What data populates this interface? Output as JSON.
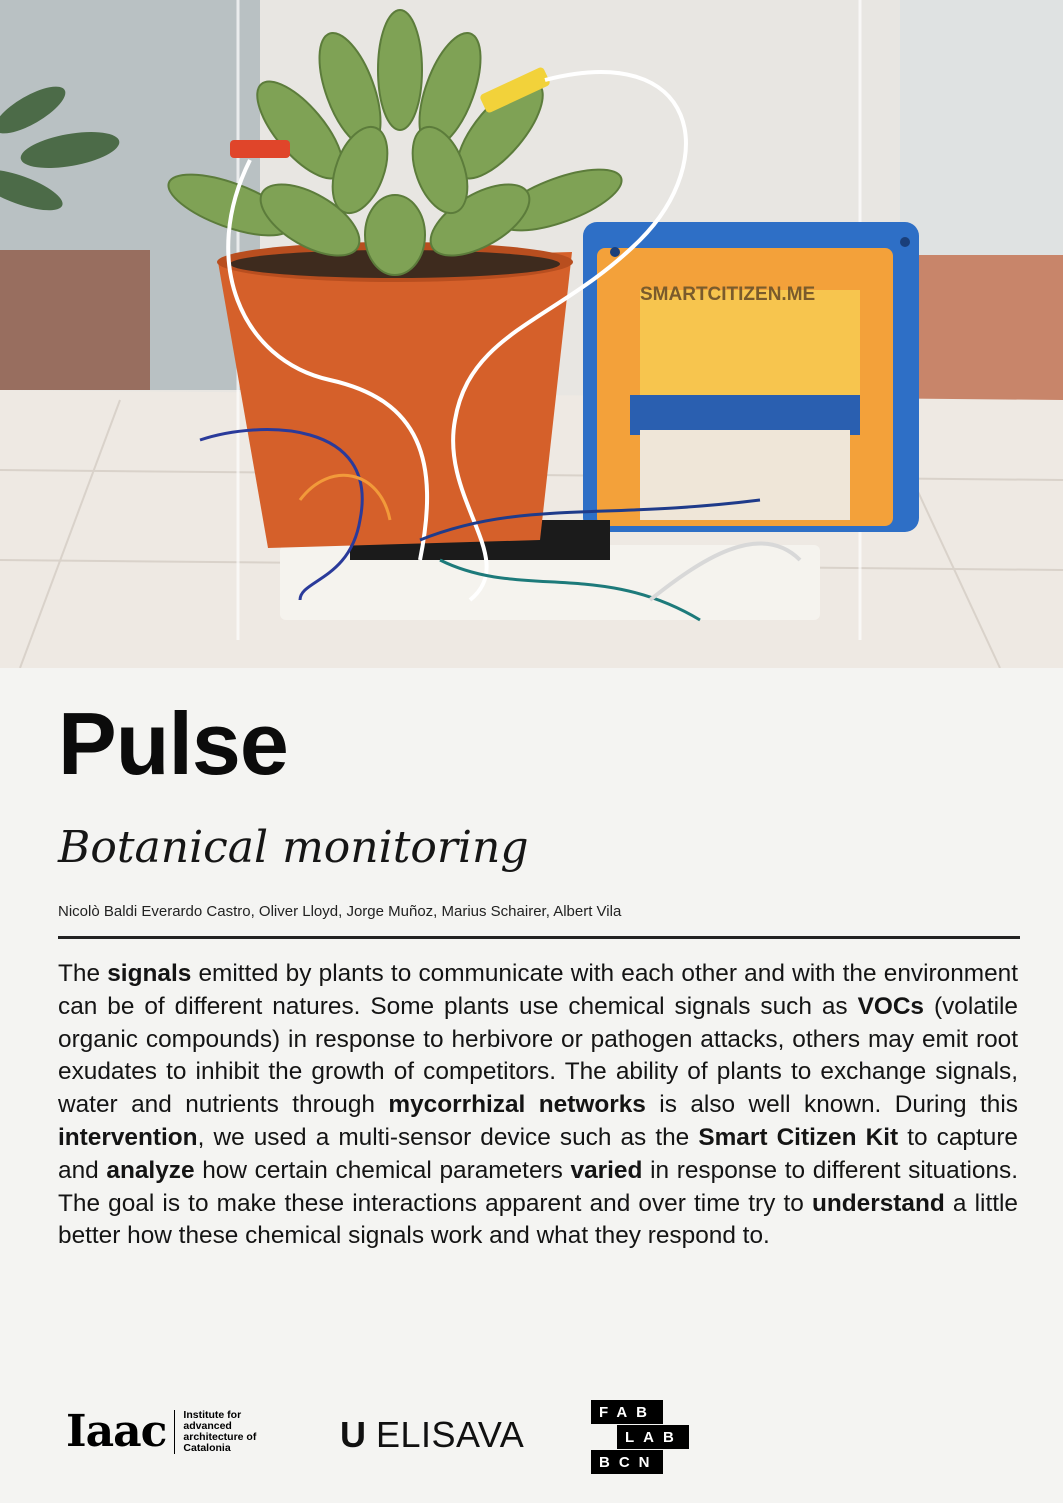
{
  "title": "Pulse",
  "subtitle": "Botanical monitoring",
  "authors": "Nicolò Baldi Everardo Castro, Oliver Lloyd, Jorge Muñoz, Marius Schairer, Albert Vila",
  "photo": {
    "device_label": "SMARTCITIZEN.ME"
  },
  "body": {
    "p1": "The ",
    "b1": "signals",
    "p2": " emitted by plants to communicate with each other and with the environment can be of different natures. Some plants use chemical signals such as ",
    "b2": "VOCs",
    "p3": " (volatile organic compounds) in response to herbivore or pathogen attacks, others may emit root exudates to inhibit the growth of competitors. The ability of plants to exchange signals, water and nutrients through ",
    "b3": "mycorrhizal networks",
    "p4": " is also well known. During this ",
    "b4": "intervention",
    "p5": ", we used a multi-sensor device such as the ",
    "b5": "Smart Citizen Kit",
    "p6": " to capture and ",
    "b6": "analyze",
    "p7": " how certain chemical parameters ",
    "b7": "varied",
    "p8": " in response to different situations. The goal is to make these interactions apparent and over time try to ",
    "b8": "understand",
    "p9": " a little better how these chemical signals work and what they respond to."
  },
  "logos": {
    "iaac_mark": "Iaac",
    "iaac_caption": "Institute for advanced architecture of Catalonia",
    "elisava_u": "U",
    "elisava_name": "ELISAVA",
    "fablab_row1": "FAB",
    "fablab_row2": "LAB",
    "fablab_row3": "BCN"
  }
}
